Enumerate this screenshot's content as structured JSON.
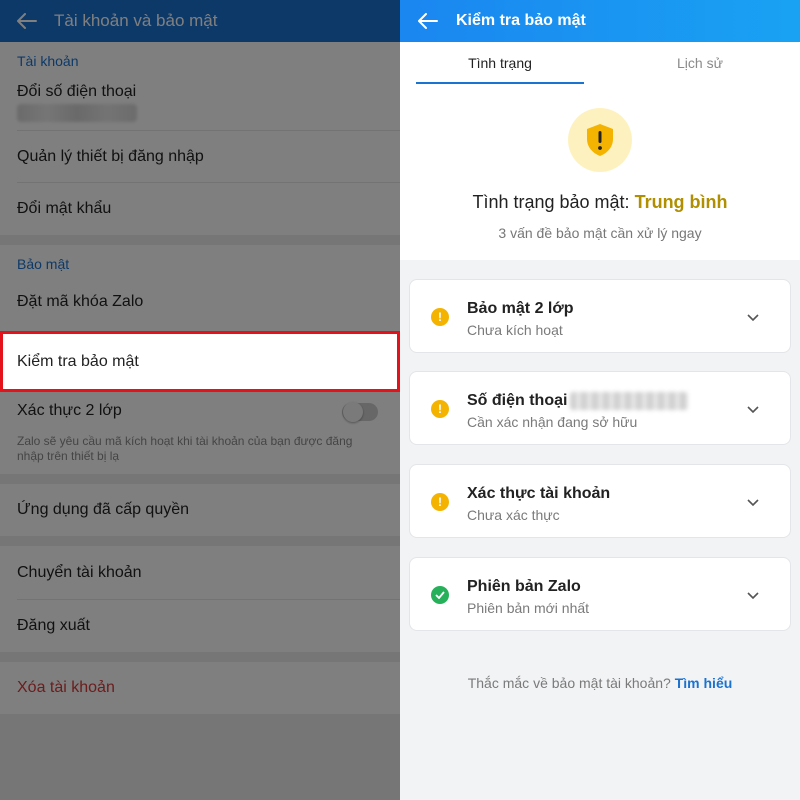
{
  "left_screen": {
    "title": "Tài khoản và bảo mật",
    "section_account": "Tài khoản",
    "item_change_phone": "Đổi số điện thoại",
    "item_manage_devices": "Quản lý thiết bị đăng nhập",
    "item_change_password": "Đổi mật khẩu",
    "section_security": "Bảo mật",
    "item_set_lock": "Đặt mã khóa Zalo",
    "item_security_check": "Kiểm tra bảo mật",
    "item_2fa": "Xác thực 2 lớp",
    "item_2fa_desc": "Zalo sẽ yêu cầu mã kích hoạt khi tài khoản của bạn được đăng nhập trên thiết bị lạ",
    "item_2fa_enabled": false,
    "item_authorized_apps": "Ứng dụng đã cấp quyền",
    "item_switch_account": "Chuyển tài khoản",
    "item_logout": "Đăng xuất",
    "item_delete_account": "Xóa tài khoản"
  },
  "right_screen": {
    "title": "Kiểm tra bảo mật",
    "tabs": [
      {
        "label": "Tình trạng",
        "active": true
      },
      {
        "label": "Lịch sử",
        "active": false
      }
    ],
    "shield_icon": "shield-warning-icon",
    "status_label": "Tình trạng bảo mật:",
    "status_value": "Trung bình",
    "status_sub": "3 vấn đề bảo mật cần xử lý ngay",
    "checks": [
      {
        "title": "Bảo mật 2 lớp",
        "subtitle": "Chưa kích hoạt",
        "status": "warning"
      },
      {
        "title": "Số điện thoại",
        "subtitle": "Cần xác nhận đang sở hữu",
        "status": "warning"
      },
      {
        "title": "Xác thực tài khoản",
        "subtitle": "Chưa xác thực",
        "status": "warning"
      },
      {
        "title": "Phiên bản Zalo",
        "subtitle": "Phiên bản mới nhất",
        "status": "ok"
      }
    ],
    "footer_text": "Thắc mắc về bảo mật tài khoản?",
    "footer_link": "Tìm hiểu"
  },
  "colors": {
    "brand_blue": "#1b73d0",
    "header_gradient_start": "#1a86f0",
    "header_gradient_end": "#19a2f3",
    "warning": "#f5b301",
    "ok": "#26b05a",
    "medium_level": "#b09000",
    "danger": "#d93a3a",
    "highlight_border": "#e3121b"
  }
}
